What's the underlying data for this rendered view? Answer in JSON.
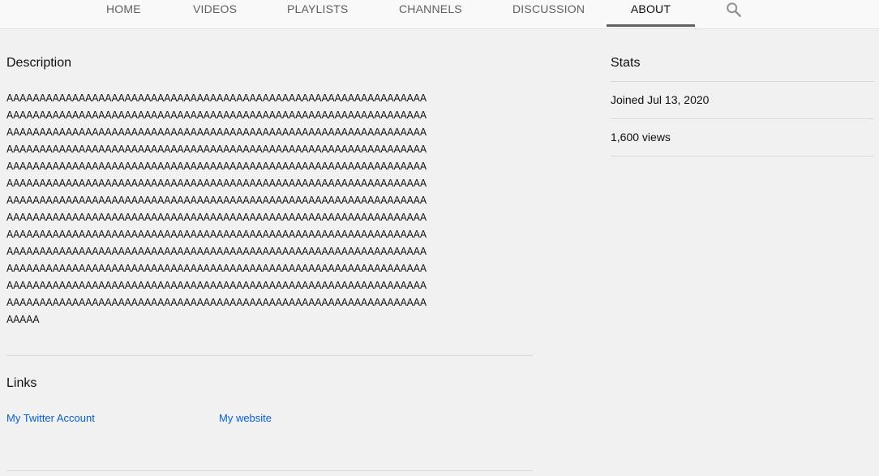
{
  "nav": {
    "tabs": [
      {
        "label": "HOME"
      },
      {
        "label": "VIDEOS"
      },
      {
        "label": "PLAYLISTS"
      },
      {
        "label": "CHANNELS"
      },
      {
        "label": "DISCUSSION"
      },
      {
        "label": "ABOUT"
      }
    ],
    "active_tab": "ABOUT",
    "search_icon": "search-icon"
  },
  "description": {
    "title": "Description",
    "lines": [
      "AAAAAAAAAAAAAAAAAAAAAAAAAAAAAAAAAAAAAAAAAAAAAAAAAAAAAAAAAAAAAAAA",
      "AAAAAAAAAAAAAAAAAAAAAAAAAAAAAAAAAAAAAAAAAAAAAAAAAAAAAAAAAAAAAAAA",
      "AAAAAAAAAAAAAAAAAAAAAAAAAAAAAAAAAAAAAAAAAAAAAAAAAAAAAAAAAAAAAAAA",
      "AAAAAAAAAAAAAAAAAAAAAAAAAAAAAAAAAAAAAAAAAAAAAAAAAAAAAAAAAAAAAAAA",
      "AAAAAAAAAAAAAAAAAAAAAAAAAAAAAAAAAAAAAAAAAAAAAAAAAAAAAAAAAAAAAAAA",
      "AAAAAAAAAAAAAAAAAAAAAAAAAAAAAAAAAAAAAAAAAAAAAAAAAAAAAAAAAAAAAAAA",
      "AAAAAAAAAAAAAAAAAAAAAAAAAAAAAAAAAAAAAAAAAAAAAAAAAAAAAAAAAAAAAAAA",
      "AAAAAAAAAAAAAAAAAAAAAAAAAAAAAAAAAAAAAAAAAAAAAAAAAAAAAAAAAAAAAAAA",
      "AAAAAAAAAAAAAAAAAAAAAAAAAAAAAAAAAAAAAAAAAAAAAAAAAAAAAAAAAAAAAAAA",
      "AAAAAAAAAAAAAAAAAAAAAAAAAAAAAAAAAAAAAAAAAAAAAAAAAAAAAAAAAAAAAAAA",
      "AAAAAAAAAAAAAAAAAAAAAAAAAAAAAAAAAAAAAAAAAAAAAAAAAAAAAAAAAAAAAAAA",
      "AAAAAAAAAAAAAAAAAAAAAAAAAAAAAAAAAAAAAAAAAAAAAAAAAAAAAAAAAAAAAAAA",
      "AAAAAAAAAAAAAAAAAAAAAAAAAAAAAAAAAAAAAAAAAAAAAAAAAAAAAAAAAAAAAAAA",
      "AAAAA"
    ]
  },
  "links": {
    "title": "Links",
    "items": [
      {
        "label": "My Twitter Account"
      },
      {
        "label": "My website"
      }
    ]
  },
  "stats": {
    "title": "Stats",
    "joined": "Joined Jul 13, 2020",
    "views": "1,600 views"
  },
  "colors": {
    "background": "#f1f1f1",
    "link": "#065fd4",
    "tab_text": "#606060"
  }
}
